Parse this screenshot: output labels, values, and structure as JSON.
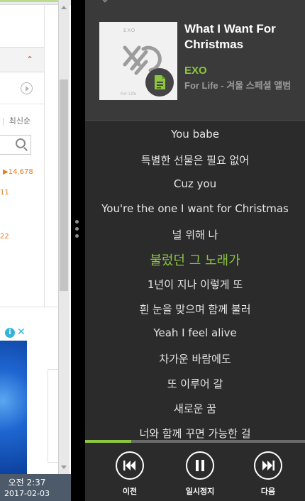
{
  "background_window": {
    "sort_label": "최신순",
    "count": "14,678",
    "n1": "11",
    "n2": "22",
    "taskbar_time": "오전 2:37",
    "taskbar_date": "2017-02-03"
  },
  "player": {
    "song_title": "What I Want For Christmas",
    "artist": "EXO",
    "album": "For Life - 겨울 스페셜 앨범",
    "progress_fraction": 0.21,
    "current_lyric_index": 5,
    "lyrics": [
      "You babe",
      "특별한 선물은 필요 없어",
      "Cuz you",
      "You're the one I want for Christmas",
      "널 위해 나",
      "불렀던 그 노래가",
      "1년이 지나 이렇게 또",
      "흰 눈을 맞으며 함께 불러",
      "Yeah I feel alive",
      "차가운 바람에도",
      "또 이루어 갈",
      "새로운 꿈",
      "너와 함께 꾸면 가능한 걸"
    ],
    "controls": {
      "prev_label": "이전",
      "pause_label": "일시정지",
      "next_label": "다음"
    },
    "colors": {
      "accent": "#8cc63f",
      "background": "#2b2b2b",
      "header_background": "#3a3a3a"
    },
    "icons": {
      "lyrics_badge": "document-icon",
      "prev": "skip-previous-icon",
      "pause": "pause-icon",
      "next": "skip-next-icon"
    }
  }
}
